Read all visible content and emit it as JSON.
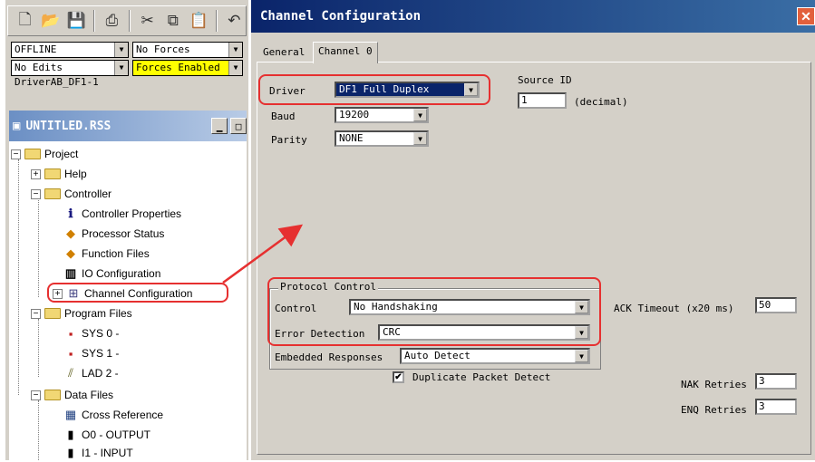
{
  "left_pane": {
    "toolbar_icons": [
      "new-file-icon",
      "open-folder-icon",
      "save-icon",
      "print-icon",
      "cut-icon",
      "copy-icon",
      "paste-icon",
      "undo-icon"
    ],
    "mode_dropdown": "OFFLINE",
    "forces_dropdown": "No Forces",
    "edits_dropdown": "No Edits",
    "forces_enabled_dropdown": "Forces Enabled",
    "driver_text": "DriverAB_DF1-1",
    "project_window_title": "UNTITLED.RSS",
    "tree": {
      "project": "Project",
      "help": "Help",
      "controller": "Controller",
      "controller_properties": "Controller Properties",
      "processor_status": "Processor Status",
      "function_files": "Function Files",
      "io_configuration": "IO Configuration",
      "channel_configuration": "Channel Configuration",
      "program_files": "Program Files",
      "sys0": "SYS 0 -",
      "sys1": "SYS 1 -",
      "lad2": "LAD 2 -",
      "data_files": "Data Files",
      "cross_reference": "Cross Reference",
      "o0_output": "O0 - OUTPUT",
      "i1_input": "I1 - INPUT"
    }
  },
  "dialog": {
    "title": "Channel Configuration",
    "close_symbol": "✕",
    "tabs": [
      "General",
      "Channel 0"
    ],
    "driver_label": "Driver",
    "driver_value": "DF1 Full Duplex",
    "source_id_label": "Source ID",
    "source_id_value": "1",
    "source_id_hint": "(decimal)",
    "baud_label": "Baud",
    "baud_value": "19200",
    "parity_label": "Parity",
    "parity_value": "NONE",
    "protocol_group_label": "Protocol Control",
    "control_label": "Control",
    "control_value": "No Handshaking",
    "error_detection_label": "Error Detection",
    "error_detection_value": "CRC",
    "embedded_responses_label": "Embedded Responses",
    "embedded_responses_value": "Auto Detect",
    "duplicate_packet_label": "Duplicate Packet Detect",
    "duplicate_packet_checked": "✔",
    "ack_timeout_label": "ACK Timeout (x20 ms)",
    "ack_timeout_value": "50",
    "nak_retries_label": "NAK Retries",
    "nak_retries_value": "3",
    "enq_retries_label": "ENQ Retries",
    "enq_retries_value": "3"
  },
  "colors": {
    "annotation_red": "#e63030",
    "dialog_title_bar": "#0a246a",
    "selection": "#0a246a"
  }
}
